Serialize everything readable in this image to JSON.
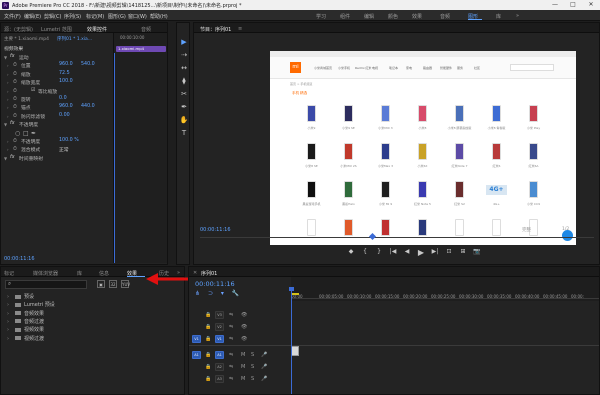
{
  "window": {
    "app_title": "Adobe Premiere Pro CC 2018 - F:\\新建\\视频剪辑\\1418125...\\新项目\\制作\\(未命名)\\未命名.prproj *",
    "min_label": "—",
    "max_label": "□",
    "close_label": "✕"
  },
  "menu": [
    "文件(F)",
    "编辑(E)",
    "剪辑(C)",
    "序列(S)",
    "标记(M)",
    "图形(G)",
    "窗口(W)",
    "帮助(H)"
  ],
  "workspaces": {
    "items": [
      "学习",
      "组件",
      "编辑",
      "颜色",
      "效果",
      "音频",
      "图形",
      "库"
    ],
    "active": "图形",
    "more": "»"
  },
  "effect_controls": {
    "tabs": [
      "源：(无剪辑)",
      "Lumetri 范围",
      "效果控件",
      "音频"
    ],
    "active_tab": "效果控件",
    "master_label": "主要 * 1.xiaomi.mp4",
    "clip_label": "序列01 * 1.xia...",
    "clip_bar_label": "1.xiaomi.mp4",
    "time_marker": "00:00:10:00",
    "section_video": "视频效果",
    "rows": [
      {
        "type": "header",
        "label": "运动",
        "fx": true
      },
      {
        "type": "prop",
        "label": "位置",
        "v1": "960.0",
        "v2": "540.0"
      },
      {
        "type": "prop",
        "label": "缩放",
        "v1": "72.5",
        "v2": ""
      },
      {
        "type": "prop",
        "label": "缩放宽度",
        "v1": "100.0",
        "v2": ""
      },
      {
        "type": "check",
        "label": "等比缩放",
        "v1": "",
        "v2": ""
      },
      {
        "type": "prop",
        "label": "旋转",
        "v1": "0.0",
        "v2": ""
      },
      {
        "type": "prop",
        "label": "锚点",
        "v1": "960.0",
        "v2": "440.0"
      },
      {
        "type": "prop",
        "label": "防闪烁滤镜",
        "v1": "0.00",
        "v2": ""
      },
      {
        "type": "header",
        "label": "不透明度",
        "fx": true
      },
      {
        "type": "mask",
        "label": "",
        "v1": "",
        "v2": ""
      },
      {
        "type": "prop",
        "label": "不透明度",
        "v1": "100.0 %",
        "v2": ""
      },
      {
        "type": "select",
        "label": "混合模式",
        "v1": "正常",
        "v2": ""
      },
      {
        "type": "header",
        "label": "时间重映射",
        "fx": true
      }
    ],
    "timecode": "00:00:11:16"
  },
  "tools": [
    "▶",
    "⇢",
    "↔",
    "⧫",
    "✂",
    "✒",
    "✋",
    "T"
  ],
  "program_monitor": {
    "title": "节目：序列01",
    "menu_icon": "≡",
    "site": {
      "logo": "mi",
      "nav": [
        "小米商城首页",
        "小米手机",
        "Redmi 红米",
        "电视",
        "笔记本",
        "家电",
        "路由器",
        "智能硬件",
        "服务",
        "社区"
      ],
      "breadcrumb": "首页 > 手机频道",
      "section": "手机 精选",
      "rows": [
        {
          "colors": [
            "#3b4aa8",
            "#2c2c5e",
            "#5a7bd6",
            "#d74b6a",
            "#4a6fb8",
            "#3d6cd4",
            "#c74050"
          ],
          "labels": [
            "小米9",
            "小米9 SE",
            "小米MIX 3",
            "小米8",
            "小米8 屏幕指纹版",
            "小米8 青春版",
            "小米 Play"
          ]
        },
        {
          "colors": [
            "#1a1a1a",
            "#c0392b",
            "#2d3d8c",
            "#c9a227",
            "#5c4ba6",
            "#b83a3a",
            "#394a8c"
          ],
          "labels": [
            "小米8 SE",
            "小米MIX 2S",
            "小米Max 3",
            "小米6X",
            "红米Note 7",
            "红米6",
            "红米6A"
          ]
        },
        {
          "colors": [
            "#0f0f0f",
            "#2f6b3b",
            "#1f1f1f",
            "#3a3ab0",
            "#6a2d2d",
            "#c8d8e8",
            "#4a8cd1"
          ],
          "labels": [
            "黑鲨游戏手机",
            "黑鲨Helo",
            "小米 Mi 9",
            "红米 Note 5",
            "红米 S2",
            "4G+",
            "小米 CC9"
          ]
        },
        {
          "colors": [
            "#ffffff",
            "#e05a2a",
            "#c03030",
            "#2a3a7c",
            "#ffffff",
            "#ffffff",
            "#ffffff"
          ],
          "labels": [
            "",
            "",
            "",
            "",
            "",
            "",
            ""
          ]
        }
      ],
      "tag_4g": "4G+"
    },
    "timecode": "00:00:11:16",
    "fit_label": "适合",
    "quality_label": "完整",
    "end_time": "1/2",
    "controls": [
      "◆",
      "{",
      "}",
      "|◀",
      "◀",
      "▶",
      "▶|",
      "⊡",
      "⊞",
      "📷"
    ]
  },
  "effects_panel": {
    "tabs": [
      "标记",
      "媒体浏览器",
      "库",
      "信息",
      "效果",
      "历史"
    ],
    "active_tab": "效果",
    "more": "»",
    "search_placeholder": "",
    "items": [
      "预设",
      "Lumetri 预设",
      "音频效果",
      "音频过渡",
      "视频效果",
      "视频过渡"
    ]
  },
  "timeline": {
    "tab": "序列01",
    "timecode": "00:00:11:16",
    "ruler": [
      "00:00",
      "00:00:05:00",
      "00:00:10:00",
      "00:00:15:00",
      "00:00:20:00",
      "00:00:25:00",
      "00:00:30:00",
      "00:00:35:00",
      "00:00:40:00",
      "00:00:45:00",
      "00:00:"
    ],
    "video_tracks": [
      "V3",
      "V2",
      "V1"
    ],
    "audio_tracks": [
      "A1",
      "A2",
      "A3"
    ],
    "source_v": "V1",
    "source_a": "A1",
    "track_buttons": [
      "M",
      "S",
      "🎤"
    ]
  }
}
